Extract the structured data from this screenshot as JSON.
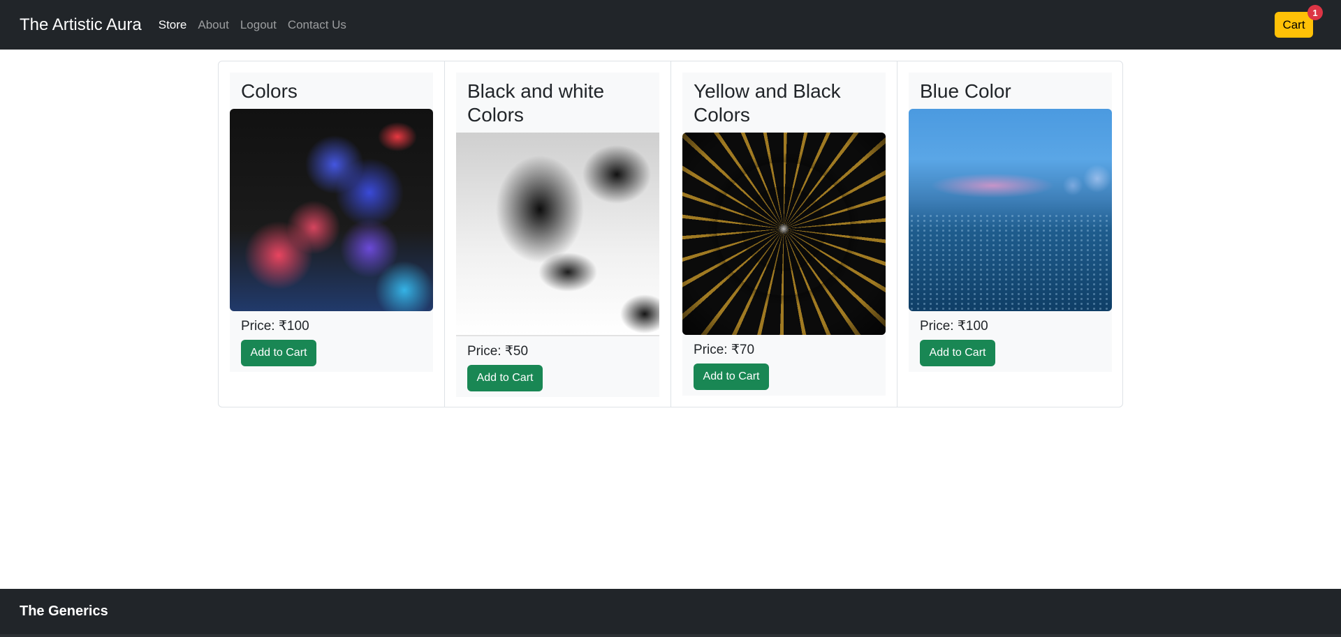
{
  "navbar": {
    "brand": "The Artistic Aura",
    "links": [
      "Store",
      "About",
      "Logout",
      "Contact Us"
    ],
    "cart_label": "Cart",
    "cart_count": "1"
  },
  "products": [
    {
      "title": "Colors",
      "price": "Price: ₹100",
      "button": "Add to Cart"
    },
    {
      "title": "Black and white Colors",
      "price": "Price: ₹50",
      "button": "Add to Cart"
    },
    {
      "title": "Yellow and Black Colors",
      "price": "Price: ₹70",
      "button": "Add to Cart"
    },
    {
      "title": "Blue Color",
      "price": "Price: ₹100",
      "button": "Add to Cart"
    }
  ],
  "footer": {
    "title": "The Generics"
  },
  "colors": {
    "navbar_bg": "#212529",
    "cart_button": "#ffc107",
    "badge": "#dc3545",
    "add_button": "#198754"
  }
}
